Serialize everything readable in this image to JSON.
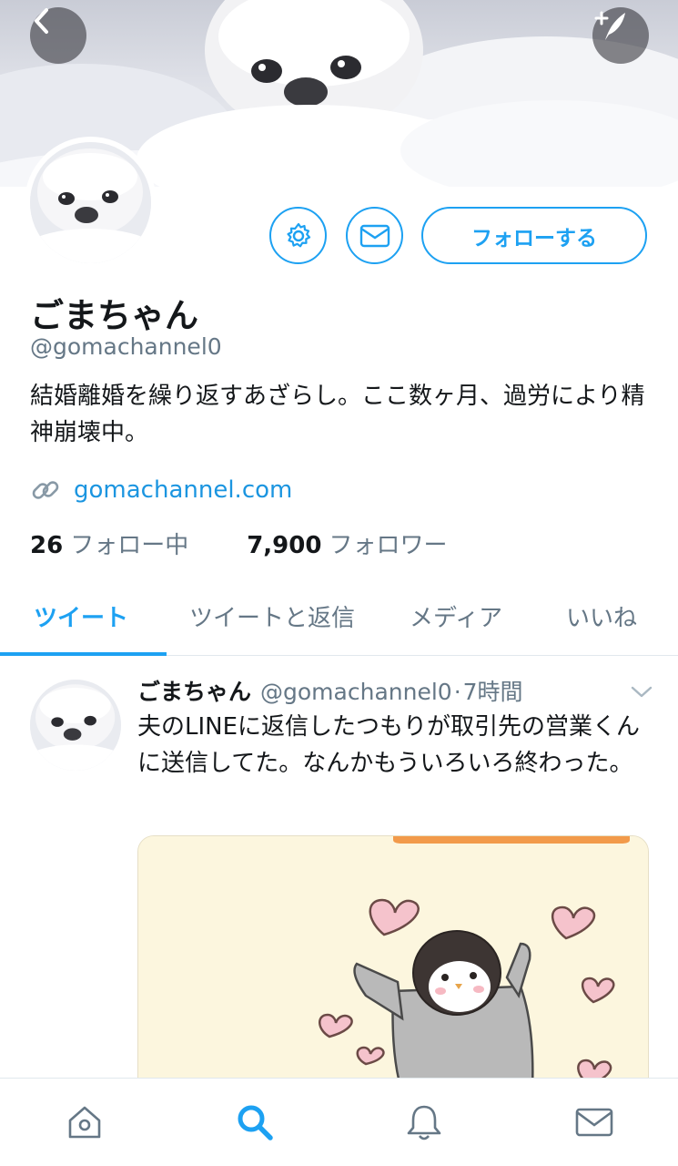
{
  "header": {
    "back_icon": "chevron-left-icon",
    "compose_icon": "compose-tweet-icon"
  },
  "profile": {
    "display_name": "ごまちゃん",
    "handle": "@gomachannel0",
    "bio": "結婚離婚を繰り返すあざらし。ここ数ヶ月、過労により精神崩壊中。",
    "link": "gomachannel.com",
    "following_count": "26",
    "following_label": "フォロー中",
    "followers_count": "7,900",
    "followers_label": "フォロワー",
    "follow_button": "フォローする"
  },
  "tabs": [
    {
      "label": "ツイート",
      "active": true
    },
    {
      "label": "ツイートと返信",
      "active": false
    },
    {
      "label": "メディア",
      "active": false
    },
    {
      "label": "いいね",
      "active": false
    }
  ],
  "tweet": {
    "name": "ごまちゃん",
    "handle": "@gomachannel0",
    "separator": "·",
    "time": "7時間",
    "text": "夫のLINEに返信したつもりが取引先の営業くんに送信してた。なんかもういろいろ終わった。"
  },
  "bottom_nav": {
    "items": [
      "home-icon",
      "search-icon",
      "notifications-icon",
      "messages-icon"
    ],
    "active": "search-icon"
  },
  "colors": {
    "accent": "#1da1f2",
    "link": "#1b95e0",
    "secondary_text": "#657786",
    "primary_text": "#14171a"
  }
}
